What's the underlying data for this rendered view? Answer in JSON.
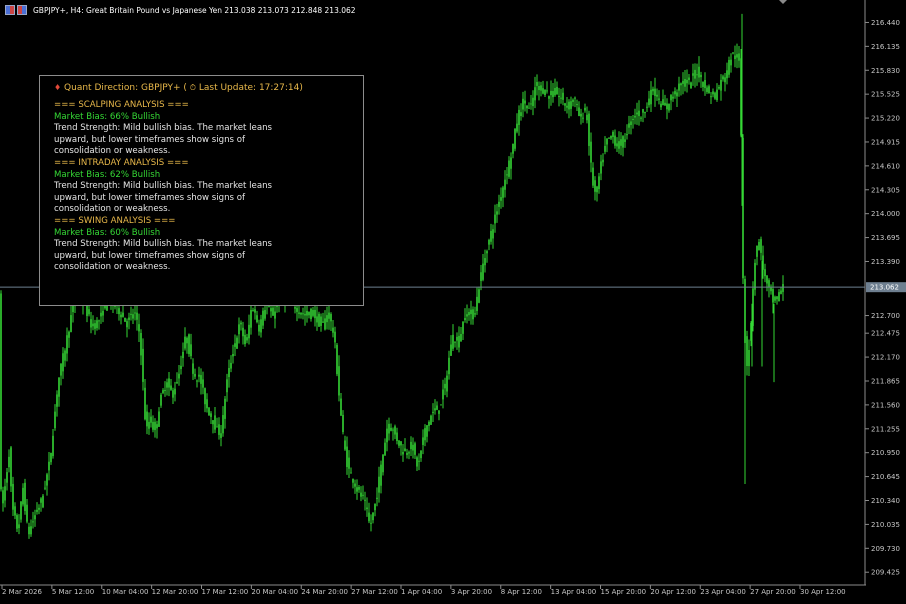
{
  "header": {
    "title": "GBPJPY+, H4:  Great Britain Pound vs Japanese Yen  213.038 213.073 212.848 213.062"
  },
  "panel": {
    "title_prefix": "Quant Direction: GBPJPY+ ( ",
    "title_suffix": " Last Update: 17:27:14)",
    "sections": [
      {
        "heading": "=== SCALPING ANALYSIS ===",
        "bias": "Market Bias: 66% Bullish",
        "trend_lines": [
          "Trend Strength: Mild bullish bias. The market leans",
          "upward, but lower timeframes show signs of",
          "consolidation or weakness."
        ]
      },
      {
        "heading": "=== INTRADAY ANALYSIS ===",
        "bias": "Market Bias: 62% Bullish",
        "trend_lines": [
          "Trend Strength: Mild bullish bias. The market leans",
          "upward, but lower timeframes show signs of",
          "consolidation or weakness."
        ]
      },
      {
        "heading": "=== SWING ANALYSIS ===",
        "bias": "Market Bias: 60% Bullish",
        "trend_lines": [
          "Trend Strength: Mild bullish bias. The market leans",
          "upward, but lower timeframes show signs of",
          "consolidation or weakness."
        ]
      }
    ]
  },
  "current_price": "213.062",
  "icons": {
    "drop": "red-drop-icon",
    "clock": "alarm-clock-icon",
    "chart_menu": "chart-window-icon",
    "scroll_marker": "shift-marker-icon"
  },
  "colors": {
    "candle": "#35d835",
    "background": "#000000",
    "axis": "#8c8c8c",
    "section": "#e8b84a",
    "bias": "#35d835",
    "text": "#e6e6e6"
  },
  "chart_data": {
    "type": "candlestick",
    "symbol": "GBPJPY+",
    "timeframe": "H4",
    "ohlc": {
      "open": 213.038,
      "high": 213.073,
      "low": 212.848,
      "close": 213.062
    },
    "y_ticks": [
      "216.440",
      "216.135",
      "215.830",
      "215.525",
      "215.220",
      "214.915",
      "214.610",
      "214.305",
      "214.000",
      "213.695",
      "213.390",
      "213.062",
      "212.700",
      "212.475",
      "212.170",
      "211.865",
      "211.560",
      "211.255",
      "210.950",
      "210.645",
      "210.340",
      "210.035",
      "209.730",
      "209.425"
    ],
    "x_ticks": [
      "2 Mar 2026",
      "5 Mar 12:00",
      "10 Mar 04:00",
      "12 Mar 20:00",
      "17 Mar 12:00",
      "20 Mar 04:00",
      "24 Mar 20:00",
      "27 Mar 12:00",
      "1 Apr 04:00",
      "3 Apr 20:00",
      "8 Apr 12:00",
      "13 Apr 04:00",
      "15 Apr 20:00",
      "20 Apr 12:00",
      "23 Apr 04:00",
      "27 Apr 20:00",
      "30 Apr 12:00"
    ],
    "ylim": [
      209.3,
      216.65
    ],
    "anchors": [
      [
        0,
        210.5
      ],
      [
        3,
        210.3
      ],
      [
        9,
        210.95
      ],
      [
        12,
        210.25
      ],
      [
        18,
        209.95
      ],
      [
        23,
        210.5
      ],
      [
        28,
        209.9
      ],
      [
        35,
        210.15
      ],
      [
        42,
        210.35
      ],
      [
        50,
        210.85
      ],
      [
        58,
        211.85
      ],
      [
        66,
        212.35
      ],
      [
        72,
        212.75
      ],
      [
        78,
        213.0
      ],
      [
        84,
        212.85
      ],
      [
        92,
        212.55
      ],
      [
        100,
        212.65
      ],
      [
        107,
        212.9
      ],
      [
        113,
        212.85
      ],
      [
        120,
        212.75
      ],
      [
        127,
        212.6
      ],
      [
        134,
        212.75
      ],
      [
        140,
        212.45
      ],
      [
        146,
        211.2
      ],
      [
        150,
        211.4
      ],
      [
        155,
        211.2
      ],
      [
        160,
        211.6
      ],
      [
        166,
        211.85
      ],
      [
        172,
        211.7
      ],
      [
        178,
        211.9
      ],
      [
        186,
        212.45
      ],
      [
        194,
        211.95
      ],
      [
        200,
        211.9
      ],
      [
        206,
        211.55
      ],
      [
        212,
        211.4
      ],
      [
        218,
        211.2
      ],
      [
        222,
        211.25
      ],
      [
        226,
        211.8
      ],
      [
        233,
        212.25
      ],
      [
        240,
        212.6
      ],
      [
        246,
        212.3
      ],
      [
        252,
        212.85
      ],
      [
        259,
        212.55
      ],
      [
        266,
        212.85
      ],
      [
        272,
        212.7
      ],
      [
        280,
        212.9
      ],
      [
        288,
        212.95
      ],
      [
        296,
        212.8
      ],
      [
        304,
        212.7
      ],
      [
        312,
        212.75
      ],
      [
        322,
        212.55
      ],
      [
        328,
        212.75
      ],
      [
        334,
        212.45
      ],
      [
        340,
        211.55
      ],
      [
        344,
        211.05
      ],
      [
        348,
        210.75
      ],
      [
        352,
        210.65
      ],
      [
        358,
        210.45
      ],
      [
        364,
        210.35
      ],
      [
        370,
        210.0
      ],
      [
        376,
        210.35
      ],
      [
        382,
        210.85
      ],
      [
        388,
        211.35
      ],
      [
        396,
        211.15
      ],
      [
        404,
        210.95
      ],
      [
        412,
        211.05
      ],
      [
        418,
        210.75
      ],
      [
        424,
        211.2
      ],
      [
        432,
        211.45
      ],
      [
        440,
        211.55
      ],
      [
        446,
        211.85
      ],
      [
        452,
        212.45
      ],
      [
        458,
        212.35
      ],
      [
        466,
        212.75
      ],
      [
        474,
        212.7
      ],
      [
        482,
        213.3
      ],
      [
        490,
        213.7
      ],
      [
        498,
        214.1
      ],
      [
        506,
        214.5
      ],
      [
        512,
        214.8
      ],
      [
        518,
        215.25
      ],
      [
        524,
        215.45
      ],
      [
        530,
        215.3
      ],
      [
        536,
        215.65
      ],
      [
        542,
        215.6
      ],
      [
        550,
        215.5
      ],
      [
        556,
        215.55
      ],
      [
        562,
        215.45
      ],
      [
        568,
        215.35
      ],
      [
        574,
        215.5
      ],
      [
        580,
        215.2
      ],
      [
        586,
        215.35
      ],
      [
        592,
        214.45
      ],
      [
        596,
        214.2
      ],
      [
        600,
        214.55
      ],
      [
        606,
        214.9
      ],
      [
        612,
        215.0
      ],
      [
        618,
        214.85
      ],
      [
        624,
        214.95
      ],
      [
        630,
        215.15
      ],
      [
        636,
        215.3
      ],
      [
        642,
        215.25
      ],
      [
        648,
        215.45
      ],
      [
        654,
        215.6
      ],
      [
        660,
        215.4
      ],
      [
        666,
        215.35
      ],
      [
        672,
        215.5
      ],
      [
        678,
        215.6
      ],
      [
        684,
        215.7
      ],
      [
        690,
        215.65
      ],
      [
        696,
        215.85
      ],
      [
        702,
        215.7
      ],
      [
        708,
        215.55
      ],
      [
        714,
        215.5
      ],
      [
        720,
        215.65
      ],
      [
        726,
        215.8
      ],
      [
        731,
        216.0
      ],
      [
        735,
        216.05
      ],
      [
        740,
        215.9
      ],
      [
        743,
        213.2
      ],
      [
        746,
        212.0
      ],
      [
        750,
        212.4
      ],
      [
        754,
        213.3
      ],
      [
        758,
        213.7
      ],
      [
        762,
        213.4
      ],
      [
        766,
        213.1
      ],
      [
        770,
        213.0
      ],
      [
        774,
        212.85
      ],
      [
        778,
        212.95
      ],
      [
        783,
        213.062
      ]
    ],
    "spikes": [
      [
        742,
        216.55
      ],
      [
        745,
        210.55
      ],
      [
        752,
        212.05
      ],
      [
        762,
        212.05
      ],
      [
        774,
        211.85
      ]
    ]
  }
}
